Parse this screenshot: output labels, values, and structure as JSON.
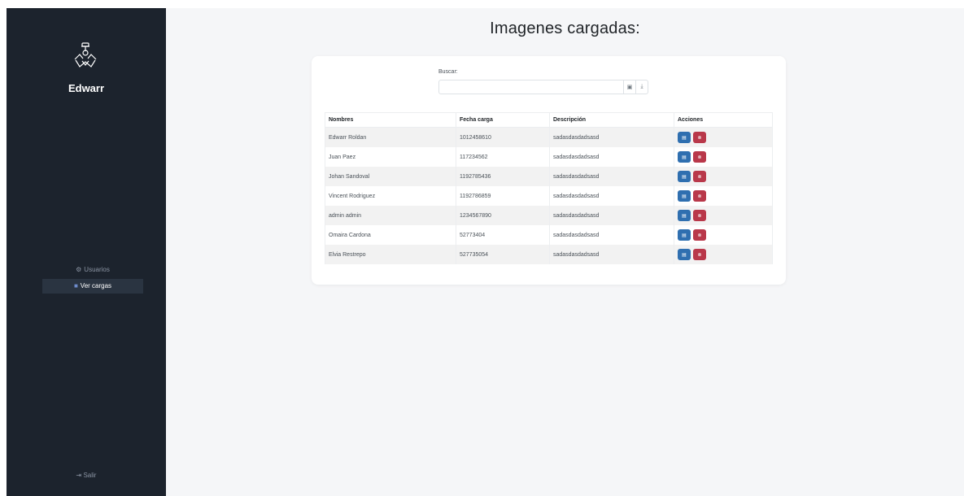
{
  "sidebar": {
    "brand": "Edwarr",
    "nav": [
      {
        "label": "Usuarios",
        "icon": "user-icon",
        "active": false
      },
      {
        "label": "Ver cargas",
        "icon": "folder-icon",
        "active": true
      }
    ],
    "logout_label": "Salir"
  },
  "main": {
    "title": "Imagenes cargadas:",
    "search": {
      "label": "Buscar:",
      "value": "",
      "placeholder": ""
    },
    "table": {
      "headers": [
        "Nombres",
        "Fecha carga",
        "Descripción",
        "Acciones"
      ],
      "rows": [
        [
          "Edwarr Roldan",
          "1012458610",
          "sadasdasdadsasd"
        ],
        [
          "Juan Paez",
          "117234562",
          "sadasdasdadsasd"
        ],
        [
          "Johan Sandoval",
          "1192785436",
          "sadasdasdadsasd"
        ],
        [
          "Vincent Rodriguez",
          "1192786859",
          "sadasdasdadsasd"
        ],
        [
          "admin admin",
          "1234567890",
          "sadasdasdadsasd"
        ],
        [
          "Omaira Cardona",
          "52773404",
          "sadasdasdadsasd"
        ],
        [
          "Elvia Restrepo",
          "527735054",
          "sadasdasdadsasd"
        ]
      ]
    }
  },
  "colors": {
    "sidebar_bg": "#1c232d",
    "edit_btn": "#2f6fb0",
    "delete_btn": "#b9384a",
    "page_bg": "#f5f6f8"
  }
}
